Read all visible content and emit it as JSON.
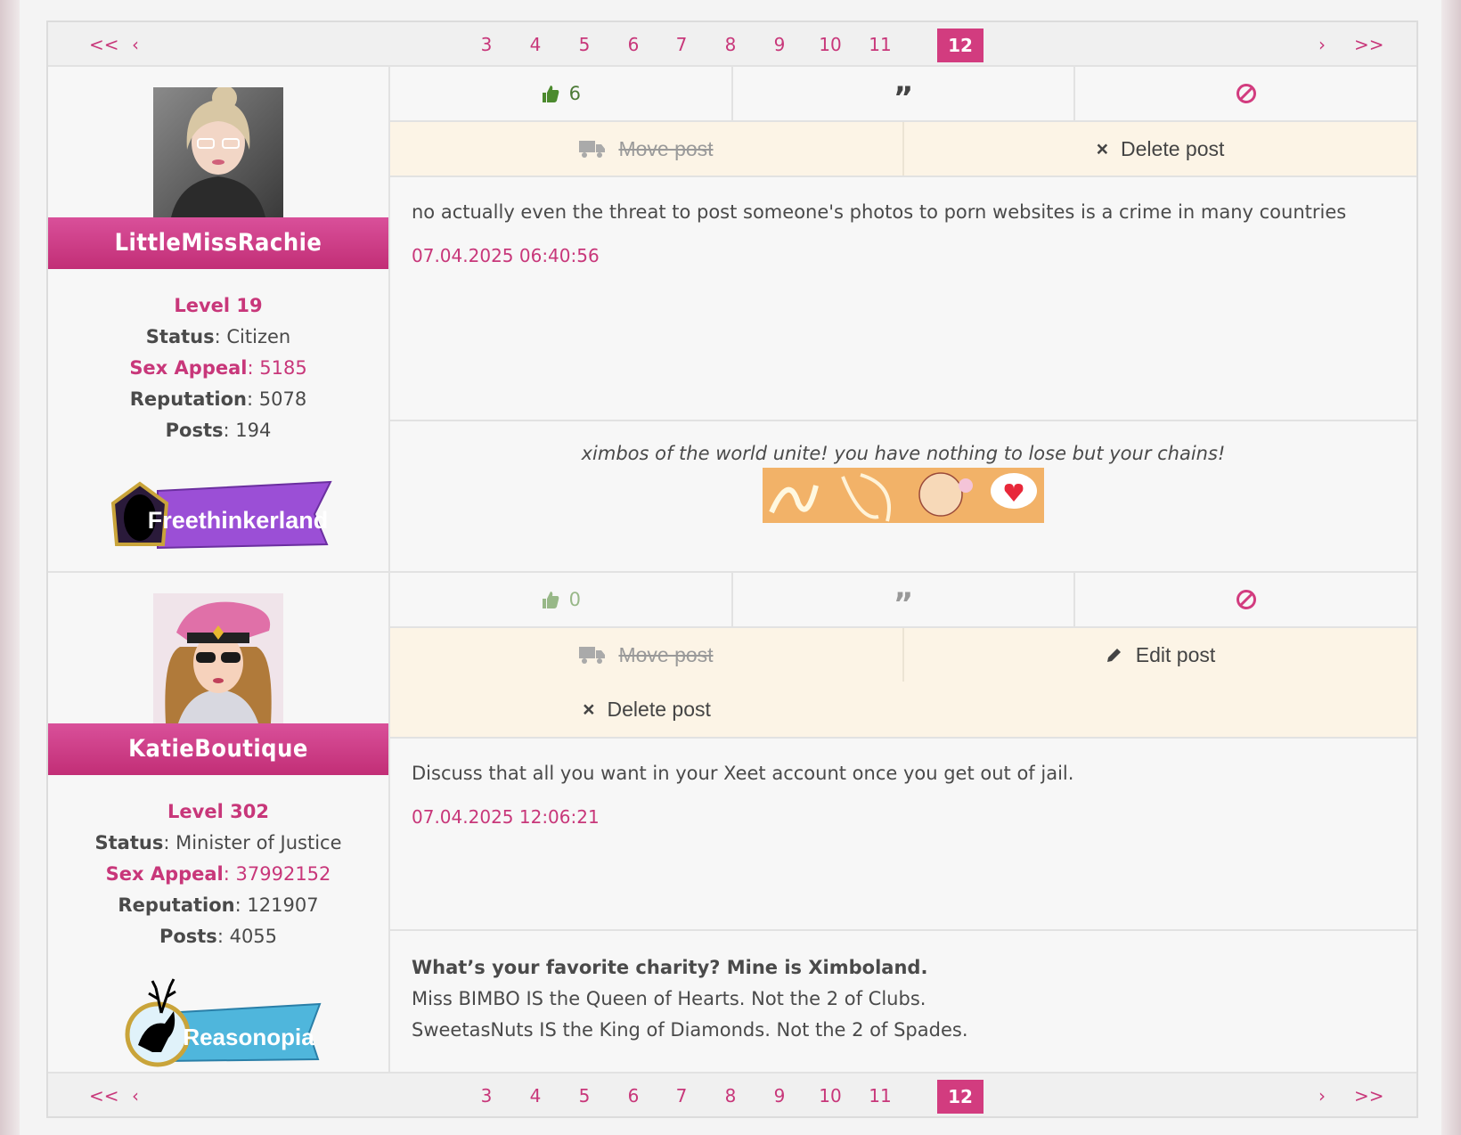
{
  "pagination": {
    "first": "<<",
    "prev": "‹",
    "pages": [
      "3",
      "4",
      "5",
      "6",
      "7",
      "8",
      "9",
      "10",
      "11"
    ],
    "current": "12",
    "next": "›",
    "last": ">>"
  },
  "colors": {
    "accent": "#d23c7f",
    "like_green": "#4c7a36",
    "mod_bg": "#fcf4e6"
  },
  "posts": [
    {
      "user": {
        "name": "LittleMissRachie",
        "level": "Level 19",
        "status_label": "Status",
        "status": "Citizen",
        "sex_appeal_label": "Sex Appeal",
        "sex_appeal": "5185",
        "reputation_label": "Reputation",
        "reputation": "5078",
        "posts_label": "Posts",
        "posts": "194",
        "badge": "Freethinkerland"
      },
      "likes": "6",
      "move_label": "Move  post",
      "delete_label": "Delete  post",
      "text": "no actually even the threat to post someone's photos to porn websites is a crime in many countries",
      "timestamp": "07.04.2025 06:40:56",
      "signature": "ximbos of the world unite! you have nothing to lose but your chains!"
    },
    {
      "user": {
        "name": "KatieBoutique",
        "level": "Level 302",
        "status_label": "Status",
        "status": "Minister of Justice",
        "sex_appeal_label": "Sex Appeal",
        "sex_appeal": "37992152",
        "reputation_label": "Reputation",
        "reputation": "121907",
        "posts_label": "Posts",
        "posts": "4055",
        "badge": "Reasonopia"
      },
      "likes": "0",
      "move_label": "Move  post",
      "edit_label": "Edit  post",
      "delete_label": "Delete  post",
      "text": "Discuss that all you want in your Xeet account once you get out of jail.",
      "timestamp": "07.04.2025 12:06:21",
      "signature_bold": "What’s your favorite charity?  Mine is Ximboland.",
      "signature_line2": "Miss BIMBO IS the Queen of Hearts.  Not the 2 of Clubs.",
      "signature_line3": "SweetasNuts IS the King of Diamonds.  Not the 2 of Spades."
    }
  ]
}
